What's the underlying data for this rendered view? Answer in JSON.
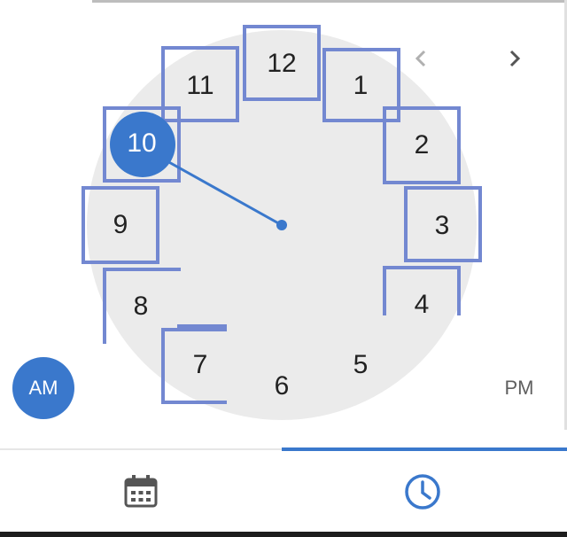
{
  "clock": {
    "hours": [
      "12",
      "1",
      "2",
      "3",
      "4",
      "5",
      "6",
      "7",
      "8",
      "9",
      "10",
      "11"
    ],
    "selected_hour": "10"
  },
  "period": {
    "am_label": "AM",
    "pm_label": "PM",
    "selected": "AM"
  },
  "navigation": {
    "prev_icon": "chevron-left-icon",
    "next_icon": "chevron-right-icon"
  },
  "tabs": [
    {
      "icon": "calendar-icon",
      "active": false
    },
    {
      "icon": "clock-icon",
      "active": true
    }
  ],
  "colors": {
    "accent": "#3a78cc",
    "cell_outline": "#7388d1",
    "face": "#ebebeb"
  }
}
